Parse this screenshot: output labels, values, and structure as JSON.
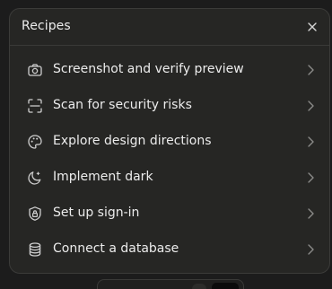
{
  "panel": {
    "title": "Recipes",
    "close_icon": "close-icon"
  },
  "recipes": [
    {
      "label": "Screenshot and verify preview",
      "icon": "camera-icon"
    },
    {
      "label": "Scan for security risks",
      "icon": "scan-frame-icon"
    },
    {
      "label": "Explore design directions",
      "icon": "palette-icon"
    },
    {
      "label": "Implement dark",
      "icon": "moon-icon"
    },
    {
      "label": "Set up sign-in",
      "icon": "lock-shield-icon"
    },
    {
      "label": "Connect a database",
      "icon": "database-icon"
    }
  ],
  "colors": {
    "background": "#1c1c1c",
    "panel": "#262624",
    "text": "#ececec",
    "icon": "#cfcfcf",
    "chevron": "#8a8a88"
  }
}
